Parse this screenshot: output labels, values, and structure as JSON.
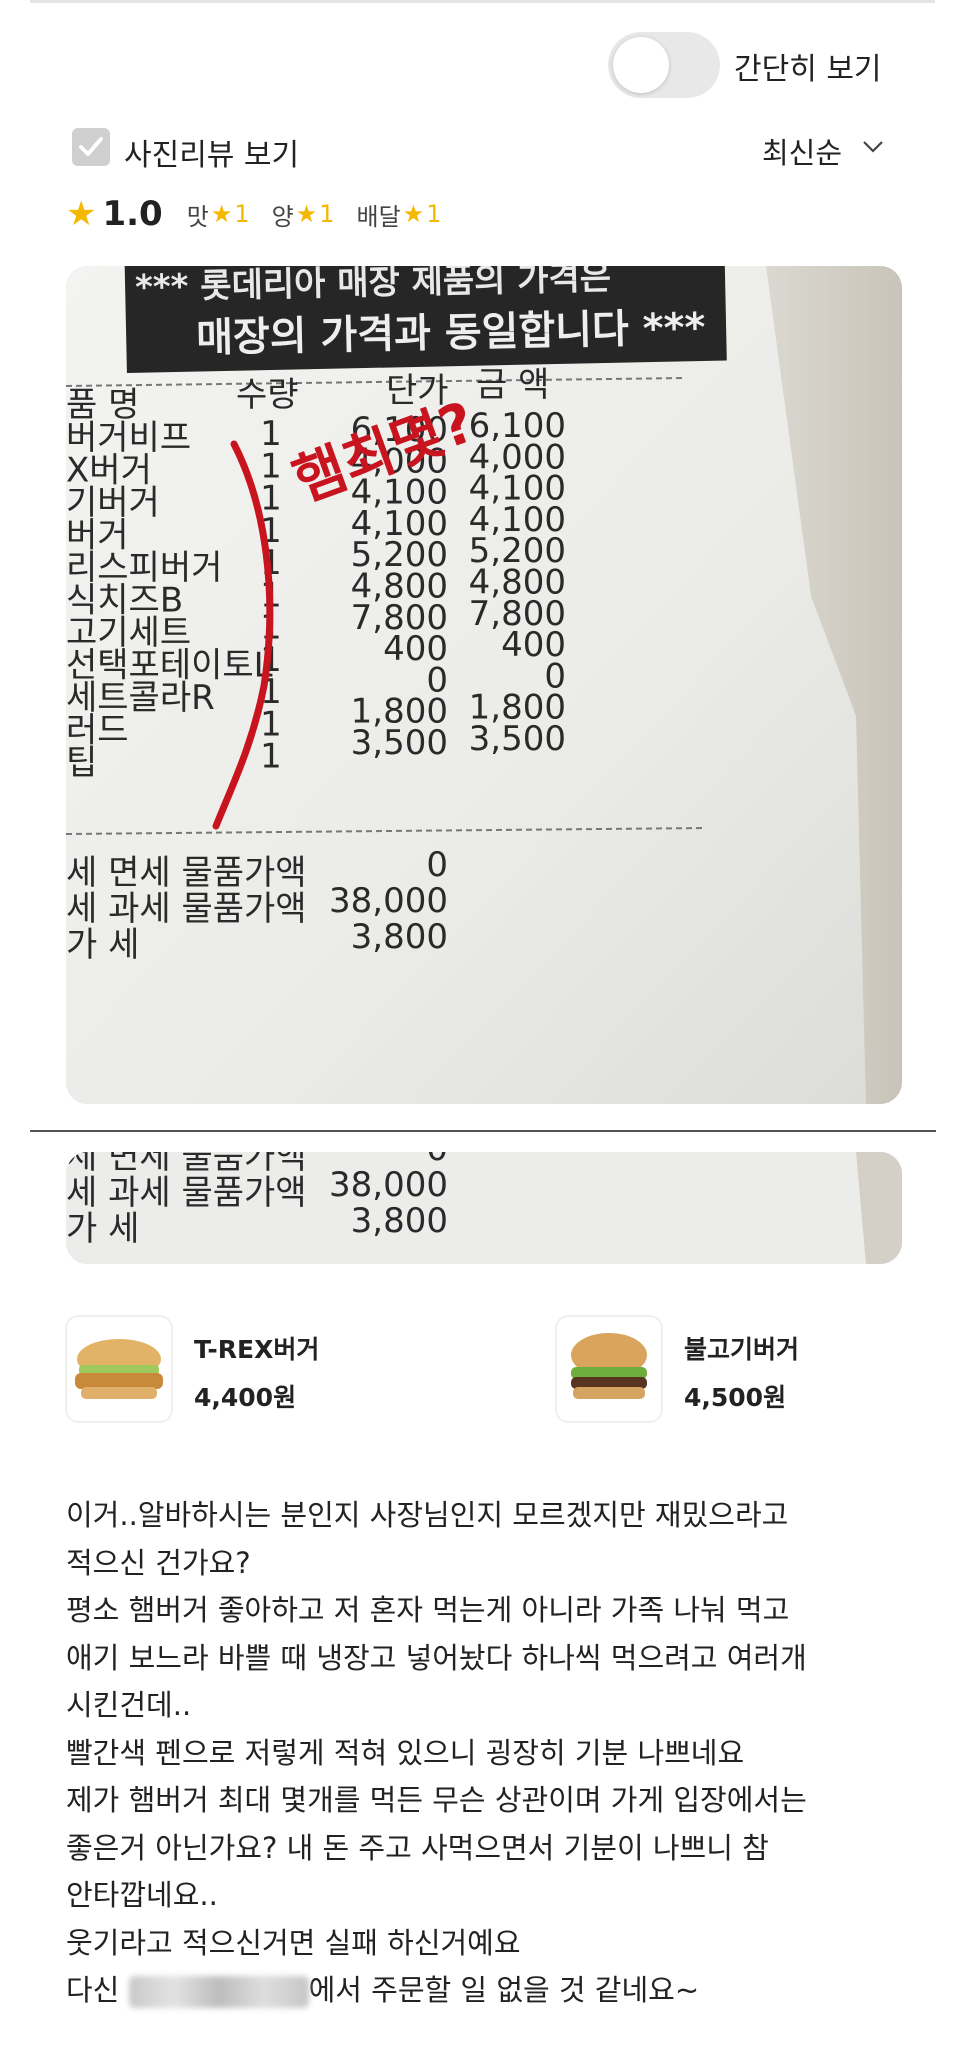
{
  "header": {
    "simple_view_label": "간단히 보기",
    "simple_view_on": false
  },
  "filters": {
    "photo_review_label": "사진리뷰 보기",
    "sort_label": "최신순"
  },
  "rating": {
    "score": "1.0",
    "taste_label": "맛",
    "taste_value": "1",
    "amount_label": "양",
    "amount_value": "1",
    "delivery_label": "배달",
    "delivery_value": "1"
  },
  "receipt": {
    "banner_line1": "*** 롯데리아 매장 제품의 가격은",
    "banner_line2": "매장의 가격과 동일합니다 ***",
    "col_name": "품 명",
    "col_qty": "수량",
    "col_price": "단가",
    "col_amount": "금 액",
    "handwritten": "햄최몇?",
    "items": [
      {
        "name": "버거비프",
        "qty": "1",
        "price": "6,100",
        "amount": "6,100"
      },
      {
        "name": "X버거",
        "qty": "1",
        "price": "4,000",
        "amount": "4,000"
      },
      {
        "name": "기버거",
        "qty": "1",
        "price": "4,100",
        "amount": "4,100"
      },
      {
        "name": "버거",
        "qty": "1",
        "price": "4,100",
        "amount": "4,100"
      },
      {
        "name": "리스피버거",
        "qty": "1",
        "price": "5,200",
        "amount": "5,200"
      },
      {
        "name": "식치즈B",
        "qty": "1",
        "price": "4,800",
        "amount": "4,800"
      },
      {
        "name": "고기세트",
        "qty": "1",
        "price": "7,800",
        "amount": "7,800"
      },
      {
        "name": "선택포테이토L",
        "qty": "1",
        "price": "400",
        "amount": "400"
      },
      {
        "name": "세트콜라R",
        "qty": "1",
        "price": "0",
        "amount": "0"
      },
      {
        "name": "러드",
        "qty": "1",
        "price": "1,800",
        "amount": "1,800"
      },
      {
        "name": "팁",
        "qty": "1",
        "price": "3,500",
        "amount": "3,500"
      }
    ],
    "totals": [
      {
        "label": "세 면세 물품가액",
        "value": "0"
      },
      {
        "label": "세 과세 물품가액",
        "value": "38,000"
      },
      {
        "label": "가          세",
        "value": "3,800"
      }
    ]
  },
  "menus": [
    {
      "name": "T-REX버거",
      "price": "4,400원"
    },
    {
      "name": "불고기버거",
      "price": "4,500원"
    }
  ],
  "review_lines": [
    "이거..알바하시는 분인지 사장님인지 모르겠지만 재밌으라고",
    "적으신 건가요?",
    "평소 햄버거 좋아하고 저 혼자 먹는게 아니라 가족 나눠 먹고",
    "애기 보느라 바쁠 때 냉장고 넣어놨다 하나씩 먹으려고 여러개",
    "시킨건데..",
    "빨간색 펜으로 저렇게 적혀 있으니 굉장히 기분 나쁘네요",
    "제가 햄버거 최대 몇개를 먹든 무슨 상관이며 가게 입장에서는",
    "좋은거 아닌가요? 내 돈 주고 사먹으면서 기분이 나쁘니 참",
    "안타깝네요..",
    "웃기라고 적으신거면 실패 하신거예요"
  ],
  "review_last": {
    "prefix": "다신",
    "suffix": "에서 주문할 일 없을 것 같네요~"
  },
  "colors": {
    "star": "#f5b800",
    "pen": "#c8141e"
  }
}
